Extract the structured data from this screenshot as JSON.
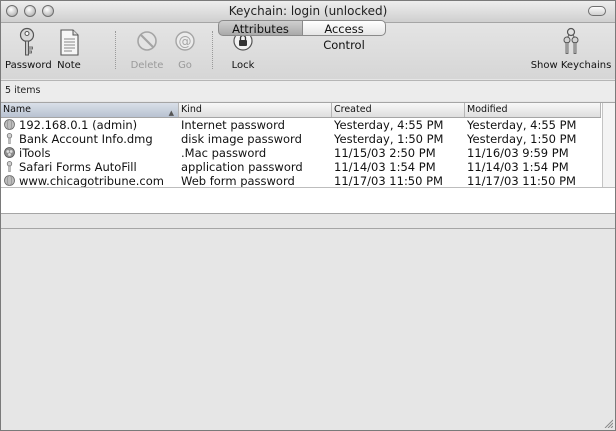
{
  "window": {
    "title": "Keychain: login (unlocked)"
  },
  "toolbar": {
    "items": [
      {
        "label": "Password",
        "icon": "key-icon",
        "enabled": true
      },
      {
        "label": "Note",
        "icon": "note-icon",
        "enabled": true
      },
      {
        "label": "Delete",
        "icon": "delete-icon",
        "enabled": false
      },
      {
        "label": "Go",
        "icon": "at-icon",
        "enabled": false
      },
      {
        "label": "Lock",
        "icon": "lock-icon",
        "enabled": true
      },
      {
        "label": "Show Keychains",
        "icon": "keychains-icon",
        "enabled": true
      }
    ]
  },
  "status": {
    "item_count": "5 items"
  },
  "table": {
    "columns": [
      "Name",
      "Kind",
      "Created",
      "Modified"
    ],
    "sorted_column": "Name",
    "rows": [
      {
        "name": "192.168.0.1 (admin)",
        "kind": "Internet password",
        "created": "Yesterday, 4:55 PM",
        "modified": "Yesterday, 4:55 PM",
        "icon": "globe-icon"
      },
      {
        "name": "Bank Account Info.dmg",
        "kind": "disk image password",
        "created": "Yesterday, 1:50 PM",
        "modified": "Yesterday, 1:50 PM",
        "icon": "key-small-icon"
      },
      {
        "name": "iTools",
        "kind": ".Mac password",
        "created": "11/15/03 2:50 PM",
        "modified": "11/16/03 9:59 PM",
        "icon": "itools-icon"
      },
      {
        "name": "Safari Forms AutoFill",
        "kind": "application password",
        "created": "11/14/03 1:54 PM",
        "modified": "11/14/03 1:54 PM",
        "icon": "key-small-icon"
      },
      {
        "name": "www.chicagotribune.com",
        "kind": "Web form password",
        "created": "11/17/03 11:50 PM",
        "modified": "11/17/03 11:50 PM",
        "icon": "globe-icon"
      }
    ]
  },
  "tabs": {
    "items": [
      "Attributes",
      "Access Control"
    ],
    "selected": "Attributes"
  }
}
